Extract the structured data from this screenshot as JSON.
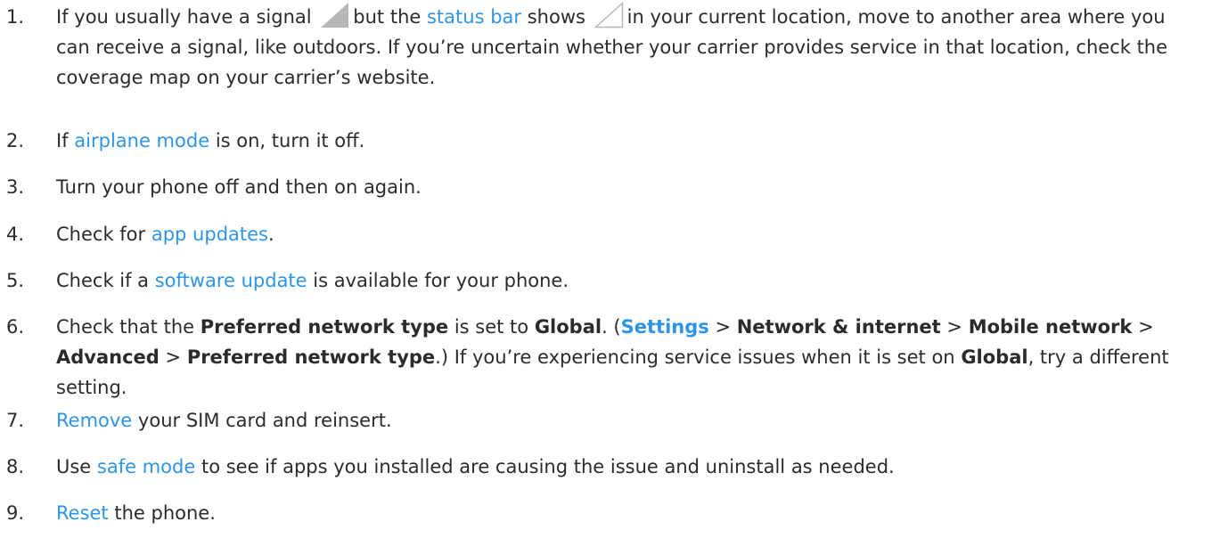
{
  "steps": [
    {
      "number": "1.",
      "t1": "If you usually have a signal",
      "icon1": "signal-full-icon",
      "t2": "but the",
      "link1": "status bar",
      "t3": "shows",
      "icon2": "signal-empty-icon",
      "t4": "in your current location, move to another area where you can receive a signal, like outdoors. If you’re uncertain whether your carrier provides service in that location, check the coverage map on your carrier’s website."
    },
    {
      "number": "2.",
      "t1": "If",
      "link1": "airplane mode",
      "t2": "is on, turn it off."
    },
    {
      "number": "3.",
      "t1": "Turn your phone off and then on again."
    },
    {
      "number": "4.",
      "t1": "Check for",
      "link1": "app updates",
      "t2": "."
    },
    {
      "number": "5.",
      "t1": "Check if a",
      "link1": "software update",
      "t2": "is available for your phone."
    },
    {
      "number": "6.",
      "t1": "Check that the",
      "b1": "Preferred network type",
      "t2": "is set to",
      "b2": "Global",
      "t3": ". (",
      "link1": "Settings",
      "t4": ">",
      "b3": "Network & internet",
      "t5": ">",
      "b4": "Mobile network",
      "t6": ">",
      "b5": "Advanced",
      "t7": ">",
      "b6": "Preferred network type",
      "t8": ".) If you’re experiencing service issues when it is set on",
      "b7": "Global",
      "t9": ", try a different setting."
    },
    {
      "number": "7.",
      "link1": "Remove",
      "t1": "your SIM card and reinsert."
    },
    {
      "number": "8.",
      "t1": "Use",
      "link1": "safe mode",
      "t2": "to see if apps you installed are causing the issue and uninstall as needed."
    },
    {
      "number": "9.",
      "link1": "Reset",
      "t1": "the phone."
    }
  ],
  "colors": {
    "text": "#2b2b2b",
    "link": "#2e95e6",
    "icon_fill": "#b7b7b7"
  }
}
